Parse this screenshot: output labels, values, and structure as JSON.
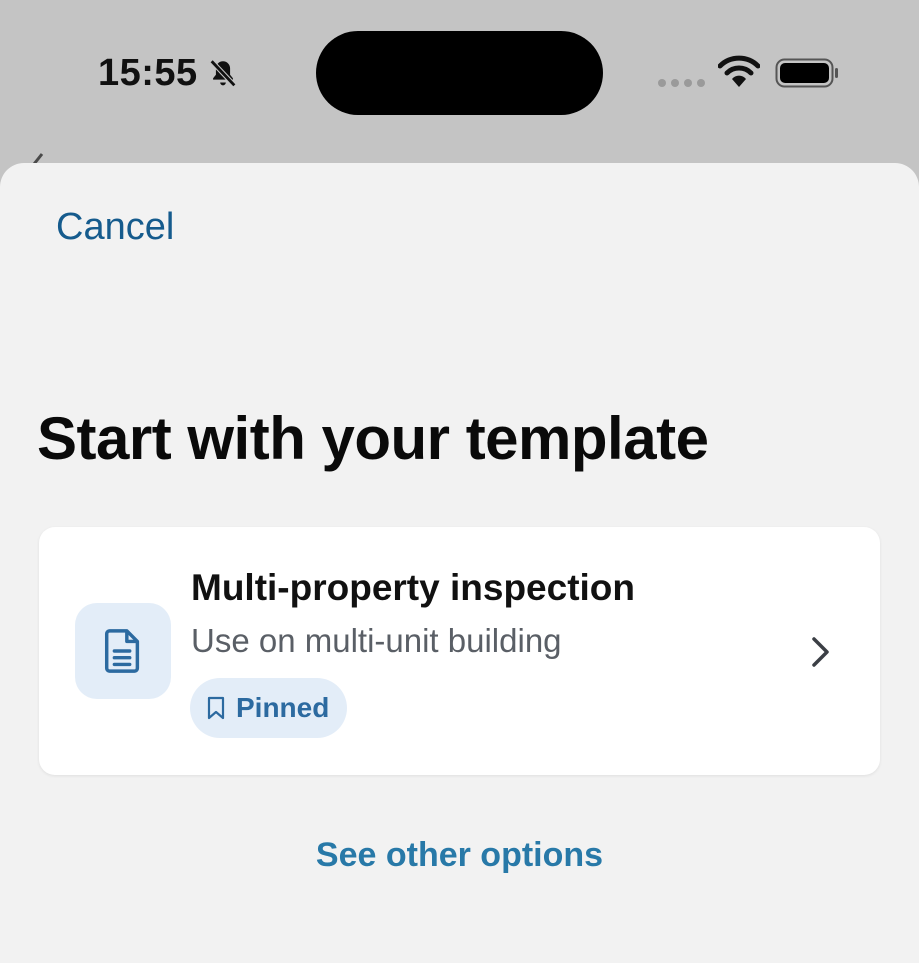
{
  "status_bar": {
    "time": "15:55",
    "bell_icon": "bell-slash-icon",
    "wifi_icon": "wifi-icon",
    "battery_icon": "battery-icon"
  },
  "sheet": {
    "cancel_label": "Cancel",
    "title": "Start with your template",
    "template_card": {
      "icon": "document-icon",
      "title": "Multi-property inspection",
      "subtitle": "Use on multi-unit building",
      "badge": {
        "icon": "bookmark-icon",
        "label": "Pinned"
      },
      "chevron_icon": "chevron-right-icon"
    },
    "see_other_options_label": "See other options"
  },
  "colors": {
    "accent": "#155b8d",
    "link": "#2879a8",
    "badge_bg": "#e3edf8",
    "badge_text": "#2c6aa0",
    "sheet_bg": "#f2f2f2",
    "backdrop": "#c4c4c4"
  }
}
